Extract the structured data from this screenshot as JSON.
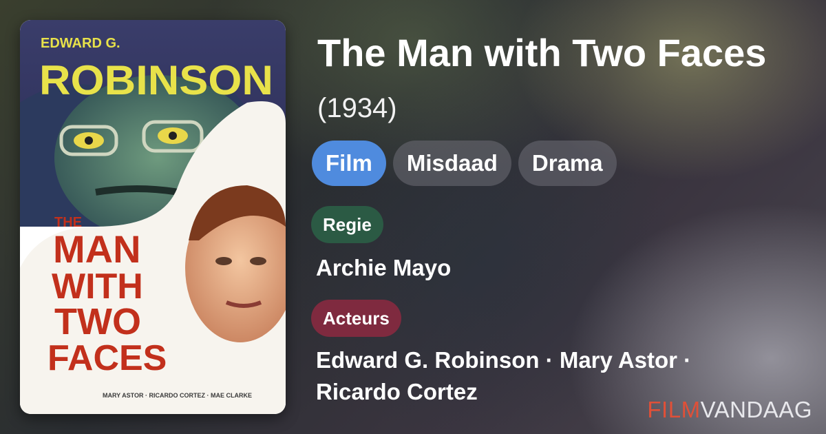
{
  "movie": {
    "title": "The Man with Two Faces",
    "year": "(1934)"
  },
  "genres": [
    "Film",
    "Misdaad",
    "Drama"
  ],
  "director": {
    "label": "Regie",
    "name": "Archie Mayo"
  },
  "cast": {
    "label": "Acteurs",
    "line1": "Edward G. Robinson · Mary Astor ·",
    "line2": "Ricardo Cortez"
  },
  "poster": {
    "top_text": "EDWARD G.",
    "star_name": "ROBINSON",
    "title_line1": "THE",
    "title_line2": "MAN",
    "title_line3": "WITH",
    "title_line4": "TWO",
    "title_line5": "FACES",
    "credits": "MARY ASTOR · RICARDO CORTEZ · MAE CLARKE"
  },
  "brand": {
    "part1": "FILM",
    "part2": "VANDAAG"
  },
  "colors": {
    "genre_primary": "#4f8bde",
    "genre_default": "rgba(110,110,118,0.55)",
    "regie_badge": "#2b5a44",
    "acteurs_badge": "#7f2a3f",
    "brand_red": "#e05038"
  }
}
